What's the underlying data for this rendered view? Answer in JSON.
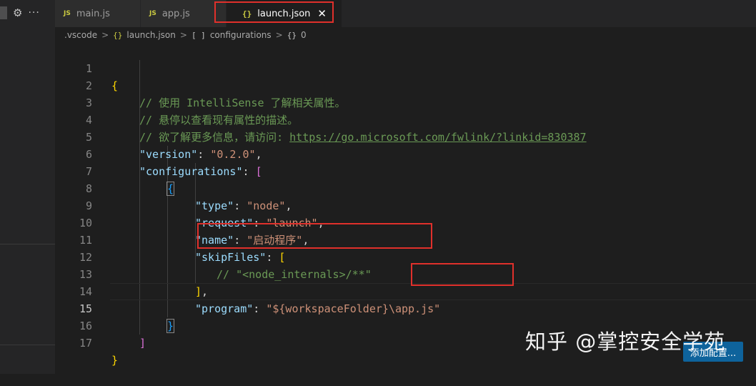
{
  "sidebar": {
    "gear_icon": "gear-icon",
    "more_icon": "more-icon"
  },
  "tabs": [
    {
      "badge": "JS",
      "label": "main.js"
    },
    {
      "badge": "JS",
      "label": "app.js"
    },
    {
      "badge": "{}",
      "label": "launch.json",
      "close": "✕"
    }
  ],
  "breadcrumb": {
    "folder": ".vscode",
    "file_badge": "{}",
    "file": "launch.json",
    "array_badge": "[ ]",
    "array": "configurations",
    "obj_badge": "{}",
    "obj": "0"
  },
  "editor": {
    "lines": [
      {
        "n": "1"
      },
      {
        "n": "2"
      },
      {
        "n": "3"
      },
      {
        "n": "4"
      },
      {
        "n": "5"
      },
      {
        "n": "6"
      },
      {
        "n": "7"
      },
      {
        "n": "8"
      },
      {
        "n": "9"
      },
      {
        "n": "10"
      },
      {
        "n": "11"
      },
      {
        "n": "12"
      },
      {
        "n": "13"
      },
      {
        "n": "14"
      },
      {
        "n": "15"
      },
      {
        "n": "16"
      },
      {
        "n": "17"
      }
    ],
    "code": {
      "l1": "{",
      "l2": "// 使用 IntelliSense 了解相关属性。",
      "l3": "// 悬停以查看现有属性的描述。",
      "l4_prefix": "// 欲了解更多信息，请访问: ",
      "l4_link": "https://go.microsoft.com/fwlink/?linkid=830387",
      "l5_key": "\"version\"",
      "l5_val": "\"0.2.0\"",
      "l6_key": "\"configurations\"",
      "l6_open": "[",
      "l7": "{",
      "l8_key": "\"type\"",
      "l8_val": "\"node\"",
      "l9_key": "\"request\"",
      "l9_val": "\"launch\"",
      "l10_key": "\"name\"",
      "l10_val": "\"启动程序\"",
      "l11_key": "\"skipFiles\"",
      "l11_open": "[",
      "l12": "// \"<node_internals>/**\"",
      "l13": "]",
      "l14_key": "\"program\"",
      "l14_val1": "\"${workspaceFolder}",
      "l14_val2": "\\app.js\"",
      "l15": "}",
      "l16": "]",
      "l17": "}"
    }
  },
  "overlay": {
    "watermark": "知乎 @掌控安全学苑",
    "button": "添加配置..."
  }
}
